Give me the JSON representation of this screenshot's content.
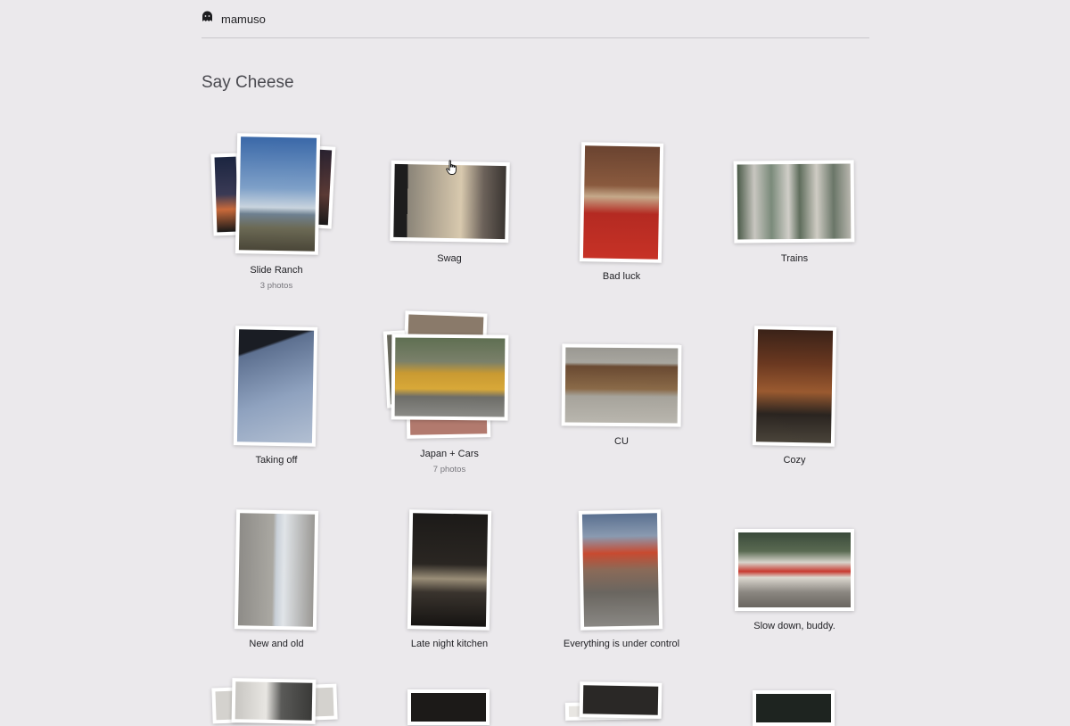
{
  "header": {
    "brand": "mamuso",
    "logo_icon": "ghost-icon"
  },
  "page": {
    "title": "Say Cheese"
  },
  "albums": [
    {
      "title": "Slide Ranch",
      "count": "3 photos"
    },
    {
      "title": "Swag"
    },
    {
      "title": "Bad luck"
    },
    {
      "title": "Trains"
    },
    {
      "title": "Taking off"
    },
    {
      "title": "Japan + Cars",
      "count": "7 photos"
    },
    {
      "title": "CU"
    },
    {
      "title": "Cozy"
    },
    {
      "title": "New and old"
    },
    {
      "title": "Late night kitchen"
    },
    {
      "title": "Everything is under control"
    },
    {
      "title": "Slow down, buddy."
    }
  ],
  "colors": {
    "background": "#ebe9ec",
    "card": "#ffffff",
    "divider": "#c9c7cb"
  }
}
